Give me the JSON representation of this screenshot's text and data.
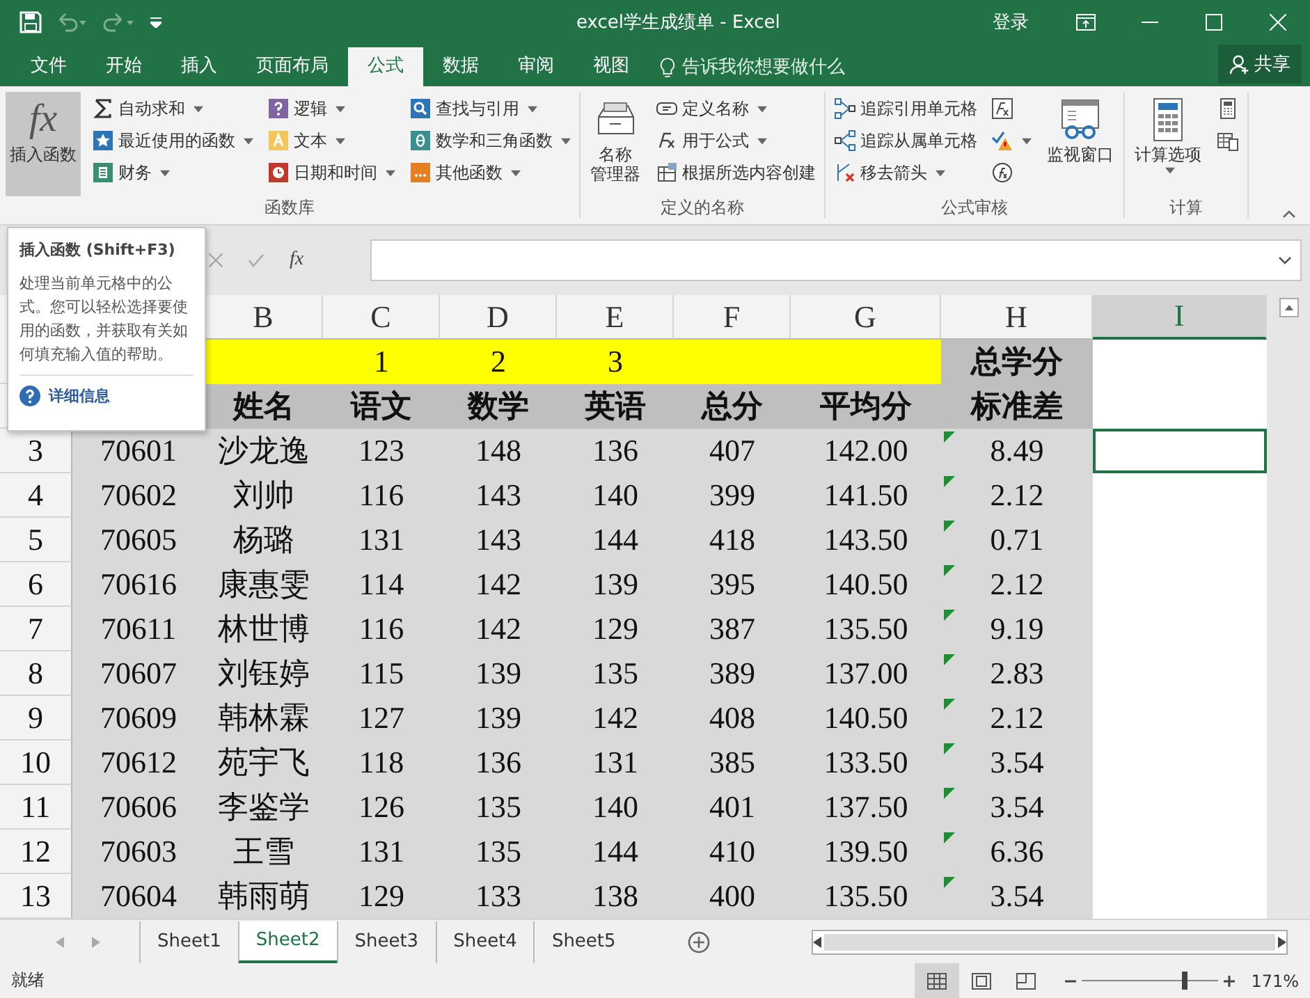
{
  "window": {
    "title": "excel学生成绩单 - Excel",
    "sign_in": "登录"
  },
  "menu_tabs": [
    {
      "label": "文件",
      "selected": false
    },
    {
      "label": "开始",
      "selected": false
    },
    {
      "label": "插入",
      "selected": false
    },
    {
      "label": "页面布局",
      "selected": false
    },
    {
      "label": "公式",
      "selected": true
    },
    {
      "label": "数据",
      "selected": false
    },
    {
      "label": "审阅",
      "selected": false
    },
    {
      "label": "视图",
      "selected": false
    }
  ],
  "tell_me": "告诉我你想要做什么",
  "share": "共享",
  "ribbon": [
    {
      "label": "函数库",
      "columns": [
        {
          "kind": "large",
          "lines": [
            "插入函数"
          ],
          "glyph": "fx",
          "pressed": true,
          "dropdown": false
        },
        {
          "kind": "stack",
          "items": [
            {
              "label": "自动求和",
              "dropdown": true
            },
            {
              "label": "最近使用的函数",
              "dropdown": true
            },
            {
              "label": "财务",
              "dropdown": true
            }
          ]
        },
        {
          "kind": "stack",
          "items": [
            {
              "label": "逻辑",
              "dropdown": true
            },
            {
              "label": "文本",
              "dropdown": true
            },
            {
              "label": "日期和时间",
              "dropdown": true
            }
          ]
        },
        {
          "kind": "stack",
          "items": [
            {
              "label": "查找与引用",
              "dropdown": true
            },
            {
              "label": "数学和三角函数",
              "dropdown": true
            },
            {
              "label": "其他函数",
              "dropdown": true
            }
          ]
        }
      ]
    },
    {
      "label": "定义的名称",
      "columns": [
        {
          "kind": "large",
          "lines": [
            "名称",
            "管理器"
          ],
          "pressed": false,
          "dropdown": false
        },
        {
          "kind": "stack",
          "items": [
            {
              "label": "定义名称",
              "dropdown": true
            },
            {
              "label": "用于公式",
              "dropdown": true
            },
            {
              "label": "根据所选内容创建",
              "dropdown": false
            }
          ]
        }
      ]
    },
    {
      "label": "公式审核",
      "columns": [
        {
          "kind": "stack",
          "items": [
            {
              "label": "追踪引用单元格",
              "dropdown": false
            },
            {
              "label": "追踪从属单元格",
              "dropdown": false
            },
            {
              "label": "移去箭头",
              "dropdown": true
            }
          ]
        },
        {
          "kind": "stack",
          "items": [
            {
              "dropdown": false
            },
            {
              "dropdown": true
            },
            {
              "dropdown": false
            }
          ]
        },
        {
          "kind": "large",
          "lines": [
            "监视窗口"
          ],
          "pressed": false,
          "dropdown": false
        }
      ]
    },
    {
      "label": "计算",
      "columns": [
        {
          "kind": "large",
          "lines": [
            "计算选项"
          ],
          "pressed": false,
          "dropdown": true
        },
        {
          "kind": "stack",
          "items": [
            {
              "dropdown": false
            },
            {
              "dropdown": false
            }
          ]
        }
      ]
    }
  ],
  "tooltip": {
    "title": "插入函数 (Shift+F3)",
    "body": "处理当前单元格中的公式。您可以轻松选择要使用的函数，并获取有关如何填充输入值的帮助。",
    "link": "详细信息"
  },
  "formula_bar": {
    "fx": "fx"
  },
  "columns": [
    {
      "label": "B",
      "selected": false
    },
    {
      "label": "C",
      "selected": false
    },
    {
      "label": "D",
      "selected": false
    },
    {
      "label": "E",
      "selected": false
    },
    {
      "label": "F",
      "selected": false
    },
    {
      "label": "G",
      "selected": false
    },
    {
      "label": "H",
      "selected": false
    },
    {
      "label": "I",
      "selected": true
    }
  ],
  "rows": [
    {
      "kind": "title",
      "cells": [
        null,
        null,
        "1",
        "2",
        "3",
        null,
        null,
        "总学分"
      ],
      "error": false,
      "selected": false
    },
    {
      "kind": "header",
      "cells": [
        null,
        "姓名",
        "语文",
        "数学",
        "英语",
        "总分",
        "平均分",
        "标准差"
      ],
      "error": false,
      "selected": false
    },
    {
      "kind": "data",
      "number": "3",
      "cells": [
        "70601",
        "沙龙逸",
        "123",
        "148",
        "136",
        "407",
        "142.00",
        "8.49"
      ],
      "error": true,
      "selected": true
    },
    {
      "kind": "data",
      "number": "4",
      "cells": [
        "70602",
        "刘帅",
        "116",
        "143",
        "140",
        "399",
        "141.50",
        "2.12"
      ],
      "error": true,
      "selected": false
    },
    {
      "kind": "data",
      "number": "5",
      "cells": [
        "70605",
        "杨璐",
        "131",
        "143",
        "144",
        "418",
        "143.50",
        "0.71"
      ],
      "error": true,
      "selected": false
    },
    {
      "kind": "data",
      "number": "6",
      "cells": [
        "70616",
        "康惠雯",
        "114",
        "142",
        "139",
        "395",
        "140.50",
        "2.12"
      ],
      "error": true,
      "selected": false
    },
    {
      "kind": "data",
      "number": "7",
      "cells": [
        "70611",
        "林世博",
        "116",
        "142",
        "129",
        "387",
        "135.50",
        "9.19"
      ],
      "error": true,
      "selected": false
    },
    {
      "kind": "data",
      "number": "8",
      "cells": [
        "70607",
        "刘钰婷",
        "115",
        "139",
        "135",
        "389",
        "137.00",
        "2.83"
      ],
      "error": true,
      "selected": false
    },
    {
      "kind": "data",
      "number": "9",
      "cells": [
        "70609",
        "韩林霖",
        "127",
        "139",
        "142",
        "408",
        "140.50",
        "2.12"
      ],
      "error": true,
      "selected": false
    },
    {
      "kind": "data",
      "number": "10",
      "cells": [
        "70612",
        "苑宇飞",
        "118",
        "136",
        "131",
        "385",
        "133.50",
        "3.54"
      ],
      "error": true,
      "selected": false
    },
    {
      "kind": "data",
      "number": "11",
      "cells": [
        "70606",
        "李鉴学",
        "126",
        "135",
        "140",
        "401",
        "137.50",
        "3.54"
      ],
      "error": true,
      "selected": false
    },
    {
      "kind": "data",
      "number": "12",
      "cells": [
        "70603",
        "王雪",
        "131",
        "135",
        "144",
        "410",
        "139.50",
        "6.36"
      ],
      "error": true,
      "selected": false
    },
    {
      "kind": "data",
      "number": "13",
      "cells": [
        "70604",
        "韩雨萌",
        "129",
        "133",
        "138",
        "400",
        "135.50",
        "3.54"
      ],
      "error": true,
      "selected": false
    }
  ],
  "sheet_tabs": [
    {
      "label": "Sheet1",
      "selected": false
    },
    {
      "label": "Sheet2",
      "selected": true
    },
    {
      "label": "Sheet3",
      "selected": false
    },
    {
      "label": "Sheet4",
      "selected": false
    },
    {
      "label": "Sheet5",
      "selected": false
    }
  ],
  "status": {
    "text": "就绪",
    "views": [
      {
        "selected": true
      },
      {
        "selected": false
      },
      {
        "selected": false
      }
    ],
    "zoom": {
      "level": 0.76
    },
    "zoom_text": "171%"
  }
}
